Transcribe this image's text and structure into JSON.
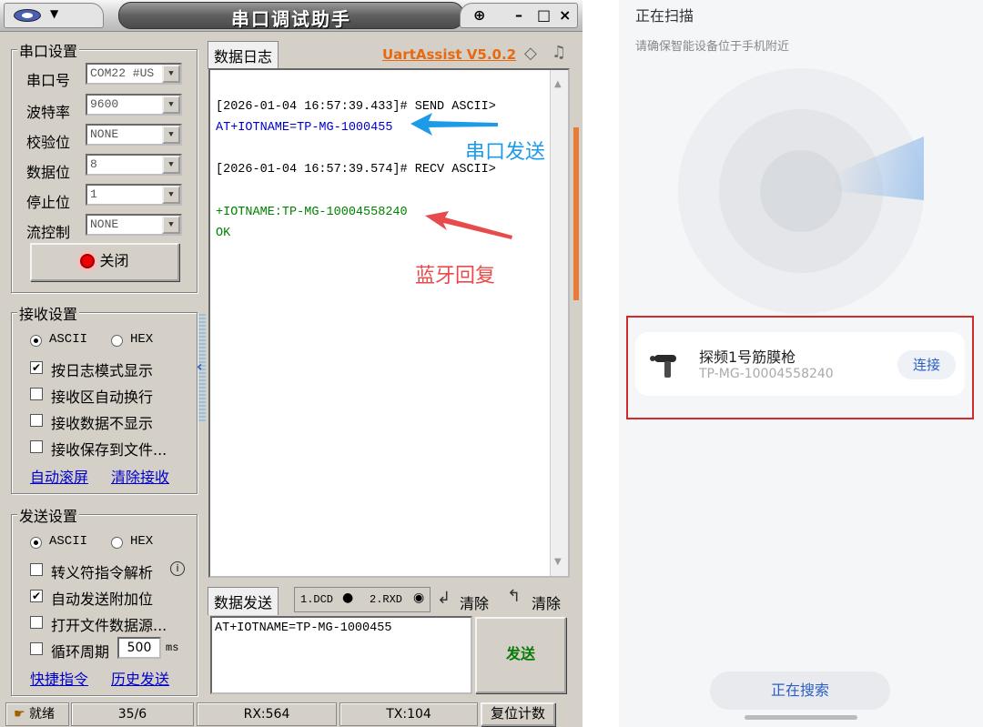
{
  "window": {
    "title": "串口调试助手",
    "brand": "UartAssist V5.0.2"
  },
  "serial_settings": {
    "group": "串口设置",
    "port_label": "串口号",
    "port_value": "COM22 #US",
    "baud_label": "波特率",
    "baud_value": "9600",
    "parity_label": "校验位",
    "parity_value": "NONE",
    "databits_label": "数据位",
    "databits_value": "8",
    "stopbits_label": "停止位",
    "stopbits_value": "1",
    "flow_label": "流控制",
    "flow_value": "NONE",
    "close_button": "关闭"
  },
  "receive_settings": {
    "group": "接收设置",
    "ascii": "ASCII",
    "hex": "HEX",
    "opt1": "按日志模式显示",
    "opt1_checked": true,
    "opt2": "接收区自动换行",
    "opt2_checked": false,
    "opt3": "接收数据不显示",
    "opt3_checked": false,
    "opt4": "接收保存到文件...",
    "opt4_checked": false,
    "link_autoscroll": "自动滚屏",
    "link_clear": "清除接收"
  },
  "send_settings": {
    "group": "发送设置",
    "ascii": "ASCII",
    "hex": "HEX",
    "opt1": "转义符指令解析",
    "opt1_checked": false,
    "opt2": "自动发送附加位",
    "opt2_checked": true,
    "opt3": "打开文件数据源...",
    "opt3_checked": false,
    "opt4": "循环周期",
    "opt4_checked": false,
    "period_value": "500",
    "period_unit": "ms",
    "link_shortcut": "快捷指令",
    "link_history": "历史发送"
  },
  "log": {
    "tab": "数据日志",
    "lines": [
      {
        "text": "[2026-01-04 16:57:39.433]# SEND ASCII>",
        "color": "#555555"
      },
      {
        "text": "AT+IOTNAME=TP-MG-1000455",
        "color": "#0000cc"
      },
      {
        "text": "[2026-01-04 16:57:39.574]# RECV ASCII>",
        "color": "#555555"
      },
      {
        "text": "+IOTNAME:TP-MG-10004558240",
        "color": "#008000"
      },
      {
        "text": "OK",
        "color": "#008000"
      }
    ],
    "annotation_send": "串口发送",
    "annotation_recv": "蓝牙回复",
    "send_arrow_color": "#1e9be8",
    "recv_arrow_color": "#e84b4b"
  },
  "send_area": {
    "tab": "数据发送",
    "dcd": "1.DCD",
    "rxd": "2.RXD",
    "clear1": "清除",
    "clear2": "清除",
    "input_value": "AT+IOTNAME=TP-MG-1000455",
    "send_button": "发送"
  },
  "statusbar": {
    "ready": "就绪",
    "count": "35/6",
    "rx": "RX:564",
    "tx": "TX:104",
    "reset": "复位计数"
  },
  "phone": {
    "title": "正在扫描",
    "subtitle": "请确保智能设备位于手机附近",
    "device_name": "探频1号筋膜枪",
    "device_id": "TP-MG-10004558240",
    "connect": "连接",
    "searching": "正在搜索",
    "accent": "#2b5ec6"
  }
}
